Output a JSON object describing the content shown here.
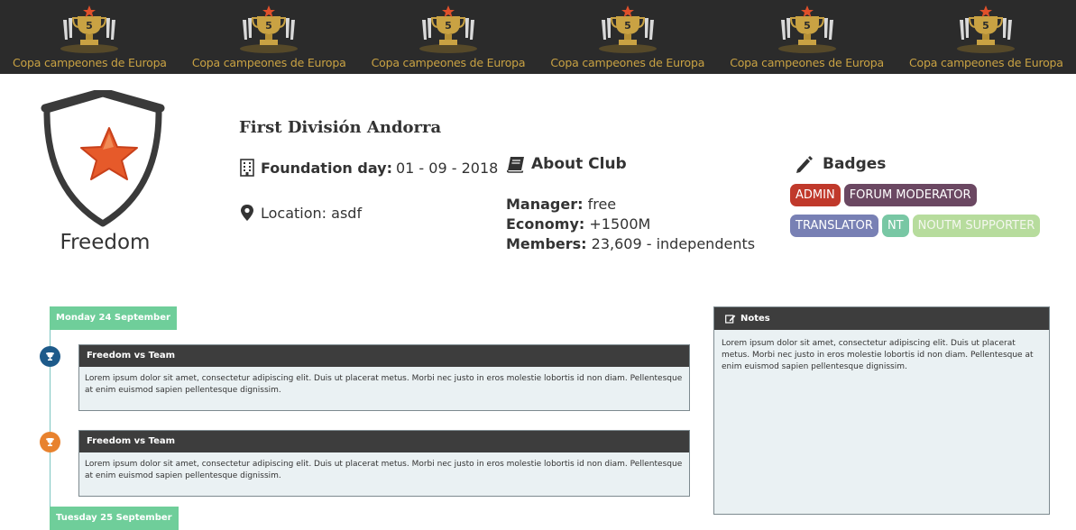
{
  "banner": {
    "trophies": [
      {
        "label": "Copa campeones de Europa",
        "number": "5"
      },
      {
        "label": "Copa campeones de Europa",
        "number": "5"
      },
      {
        "label": "Copa campeones de Europa",
        "number": "5"
      },
      {
        "label": "Copa campeones de Europa",
        "number": "5"
      },
      {
        "label": "Copa campeones de Europa",
        "number": "5"
      },
      {
        "label": "Copa campeones de Europa",
        "number": "5"
      }
    ]
  },
  "club": {
    "name": "Freedom",
    "league": "First División Andorra",
    "foundation_label": "Foundation day:",
    "foundation_value": "01 - 09 - 2018",
    "location_text": "Location: asdf"
  },
  "about": {
    "title": "About Club",
    "manager_label": "Manager:",
    "manager_value": "free",
    "economy_label": "Economy:",
    "economy_value": "+1500M",
    "members_label": "Members:",
    "members_value": "23,609 - independents"
  },
  "badges": {
    "title": "Badges",
    "items": [
      {
        "label": "ADMIN",
        "color": "#c0392b",
        "text": "#ffffff"
      },
      {
        "label": "FORUM MODERATOR",
        "color": "#6b4862",
        "text": "#ffffff"
      },
      {
        "label": "TRANSLATOR",
        "color": "#7880b4",
        "text": "#ffffff"
      },
      {
        "label": "NT",
        "color": "#78c7a4",
        "text": "#ffffff"
      },
      {
        "label": "NOUTM SUPPORTER",
        "color": "#b7dc9d",
        "text": "#f4f7ef"
      }
    ]
  },
  "timeline": {
    "dates": [
      "Monday 24 September",
      "Tuesday 25 September"
    ],
    "events": [
      {
        "title": "Freedom vs Team",
        "body": "Lorem ipsum dolor sit amet, consectetur adipiscing elit. Duis ut placerat metus. Morbi nec justo in eros molestie lobortis id non diam. Pellentesque at enim euismod sapien pellentesque dignissim.",
        "dot_color": "#1d5a8a",
        "icon": "trophy-icon"
      },
      {
        "title": "Freedom vs Team",
        "body": "Lorem ipsum dolor sit amet, consectetur adipiscing elit. Duis ut placerat metus. Morbi nec justo in eros molestie lobortis id non diam. Pellentesque at enim euismod sapien pellentesque dignissim.",
        "dot_color": "#e8822e",
        "icon": "trophy-icon"
      }
    ]
  },
  "notes": {
    "title": "Notes",
    "body": "Lorem ipsum dolor sit amet, consectetur adipiscing elit. Duis ut placerat metus. Morbi nec justo in eros molestie lobortis id non diam. Pellentesque at enim euismod sapien pellentesque dignissim."
  }
}
